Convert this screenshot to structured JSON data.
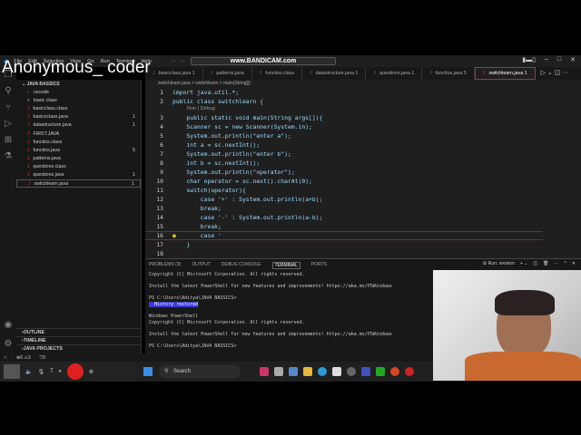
{
  "watermark": "Anonymous_ coder",
  "menu": [
    "File",
    "Edit",
    "Selection",
    "View",
    "Go",
    "Run",
    "Terminal",
    "Help"
  ],
  "search_box": "www.BANDICAM.com",
  "explorer": {
    "root": "JAVA BASSICS",
    "files": [
      {
        "name": ".vscode",
        "icon": "folder",
        "badge": ""
      },
      {
        "name": "basic class",
        "icon": "file",
        "badge": ""
      },
      {
        "name": "basicclass.class",
        "icon": "java",
        "badge": ""
      },
      {
        "name": "basicsclass.java",
        "icon": "java",
        "badge": "1"
      },
      {
        "name": "datastructure.java",
        "icon": "java",
        "badge": "1"
      },
      {
        "name": "FIRST.JAVA",
        "icon": "java",
        "badge": ""
      },
      {
        "name": "functios.class",
        "icon": "java",
        "badge": ""
      },
      {
        "name": "functios.java",
        "icon": "java",
        "badge": "5"
      },
      {
        "name": "patterns.java",
        "icon": "java",
        "badge": ""
      },
      {
        "name": "questions.class",
        "icon": "java",
        "badge": ""
      },
      {
        "name": "questions.java",
        "icon": "java",
        "badge": "1"
      },
      {
        "name": "switchlearn.java",
        "icon": "java",
        "badge": "1"
      }
    ],
    "sections": [
      "OUTLINE",
      "TIMELINE",
      "JAVA PROJECTS"
    ]
  },
  "tabs": [
    "basicclass.java 1",
    "patterns.java",
    "functios.class",
    "datastructure.java 1",
    "questions.java 1",
    "functios.java 5",
    "switchlearn.java 1"
  ],
  "breadcrumb": "switchlearn.java > switchlearn > main(String[])",
  "codelens": "Run | Debug",
  "code": [
    {
      "n": "1",
      "t": "import java.util.*;"
    },
    {
      "n": "2",
      "t": "public class switchlearn {"
    },
    {
      "n": "3",
      "t": "    public static void main(String args[]){"
    },
    {
      "n": "4",
      "t": "    Scanner sc = new Scanner(System.in);"
    },
    {
      "n": "5",
      "t": "    System.out.println(\"enter a\");"
    },
    {
      "n": "6",
      "t": "    int a = sc.nextInt();"
    },
    {
      "n": "7",
      "t": "    System.out.println(\"enter b\");"
    },
    {
      "n": "8",
      "t": "    int b = sc.nextInt();"
    },
    {
      "n": "9",
      "t": "    System.out.println(\"operator\");"
    },
    {
      "n": "10",
      "t": "    char operator = sc.next().charAt(0);"
    },
    {
      "n": "11",
      "t": "    switch(operator){"
    },
    {
      "n": "12",
      "t": "        case '+' : System.out.println(a+b);"
    },
    {
      "n": "13",
      "t": "        break;"
    },
    {
      "n": "14",
      "t": "        case '-' : System.out.println(a-b);"
    },
    {
      "n": "15",
      "t": "        break;"
    },
    {
      "n": "16",
      "t": "        case '"
    },
    {
      "n": "17",
      "t": "    }"
    },
    {
      "n": "18",
      "t": ""
    }
  ],
  "panel": {
    "tabs": [
      "PROBLEMS",
      "OUTPUT",
      "DEBUG CONSOLE",
      "TERMINAL",
      "PORTS"
    ],
    "problems_count": "9",
    "run_label": "Run: revision",
    "terminal": [
      "Copyright (C) Microsoft Corporation. All rights reserved.",
      "",
      "Install the latest PowerShell for new features and improvements! https://aka.ms/PSWindows",
      "",
      "PS C:\\Users\\Aditya\\JAVA BASSICS>",
      "  History restored",
      "",
      "Windows PowerShell",
      "Copyright (C) Microsoft Corporation. All rights reserved.",
      "",
      "Install the latest PowerShell for new features and improvements! https://aka.ms/PSWindows",
      "",
      "PS C:\\Users\\Aditya\\JAVA BASSICS>"
    ]
  },
  "status": {
    "errors": "6",
    "warnings": "3",
    "ports": "0"
  },
  "taskbar": {
    "search": "Search"
  },
  "colors": {
    "accent": "#c04040",
    "highlight": "#3b3bd6"
  }
}
